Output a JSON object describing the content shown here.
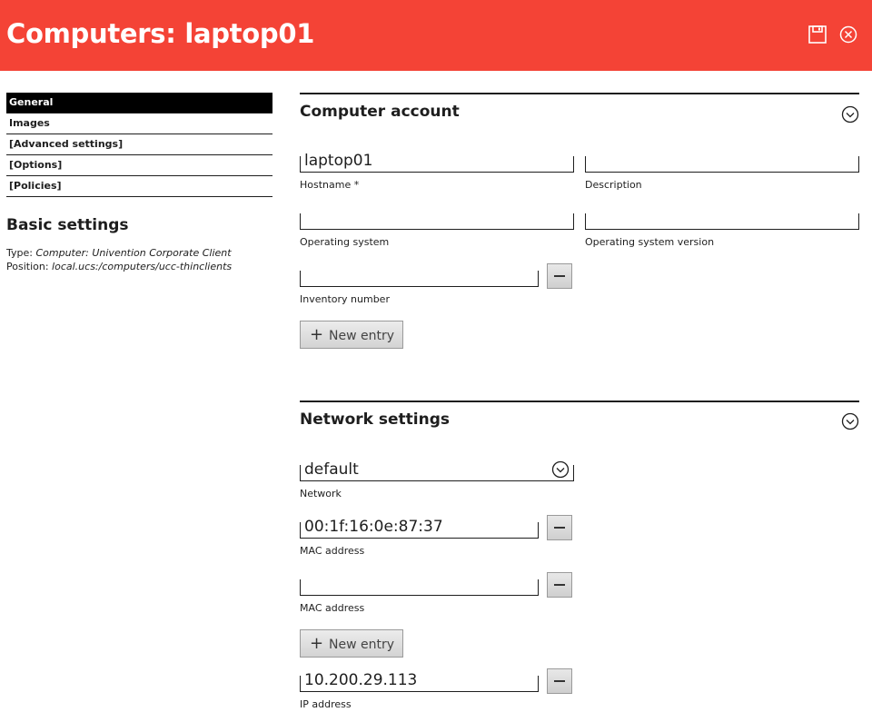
{
  "header": {
    "title": "Computers: laptop01",
    "save_icon": "save-icon",
    "close_icon": "close-icon",
    "background": "#f44336"
  },
  "nav": {
    "items": [
      {
        "label": "General",
        "active": true
      },
      {
        "label": "Images",
        "active": false
      },
      {
        "label": "[Advanced settings]",
        "active": false
      },
      {
        "label": "[Options]",
        "active": false
      },
      {
        "label": "[Policies]",
        "active": false
      }
    ]
  },
  "basic": {
    "title": "Basic settings",
    "type_label": "Type: ",
    "type_value": "Computer: Univention Corporate Client",
    "position_label": "Position: ",
    "position_value": "local.ucs:/computers/ucc-thinclients"
  },
  "computer_account": {
    "title": "Computer account",
    "hostname_value": "laptop01",
    "hostname_label": "Hostname *",
    "description_value": "",
    "description_label": "Description",
    "os_value": "",
    "os_label": "Operating system",
    "os_version_value": "",
    "os_version_label": "Operating system version",
    "inventory_value": "",
    "inventory_label": "Inventory number",
    "new_entry": "New entry"
  },
  "network": {
    "title": "Network settings",
    "network_value": "default",
    "network_label": "Network",
    "mac1_value": "00:1f:16:0e:87:37",
    "mac1_label": "MAC address",
    "mac2_value": "",
    "mac2_label": "MAC address",
    "new_entry": "New entry",
    "ip_value": "10.200.29.113",
    "ip_label": "IP address"
  }
}
